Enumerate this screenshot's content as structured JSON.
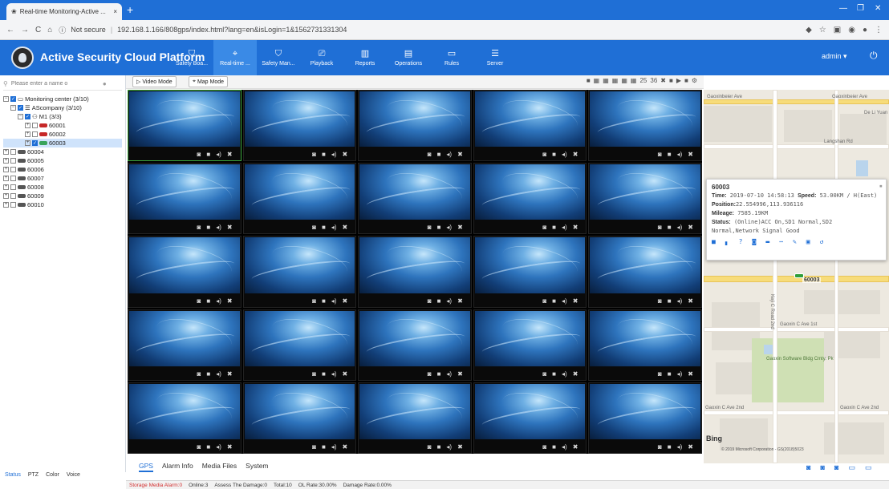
{
  "browser": {
    "tab_title": "Real-time Monitoring-Active ...",
    "not_secure": "Not secure",
    "url": "192.168.1.166/808gps/index.html?lang=en&isLogin=1&1562731331304"
  },
  "app": {
    "title": "Active Security Cloud Platform",
    "nav": [
      {
        "label": "Safety Boa..."
      },
      {
        "label": "Real-time ..."
      },
      {
        "label": "Safety Man..."
      },
      {
        "label": "Playback"
      },
      {
        "label": "Reports"
      },
      {
        "label": "Operations"
      },
      {
        "label": "Rules"
      },
      {
        "label": "Server"
      }
    ],
    "user": "admin ▾"
  },
  "sidebar": {
    "search_placeholder": "Please enter a name o",
    "tree": {
      "root": "Monitoring center (3/10)",
      "company": "AScompany (3/10)",
      "group": "M1 (3/3)",
      "vehicles": [
        "60001",
        "60002",
        "60003",
        "60004",
        "60005",
        "60006",
        "60007",
        "60008",
        "60009",
        "60010"
      ]
    },
    "bottom_tabs": [
      "Status",
      "PTZ",
      "Color",
      "Voice"
    ]
  },
  "toolbar": {
    "video_mode": "Video Mode",
    "map_mode": "Map Mode",
    "layout_25": "25",
    "layout_36": "36"
  },
  "bottom_tabs": [
    "GPS",
    "Alarm Info",
    "Media Files",
    "System"
  ],
  "map": {
    "labels": {
      "road_1": "Gaoxinbeier Ave",
      "road_2": "Gaoxinbeier Ave",
      "road_3": "Langshan Rd",
      "road_4": "Gaoxin C Ave 1st",
      "road_5": "Gaoxin C Ave 2nd",
      "road_6": "Gaoxin C Ave 2nd",
      "road_7": "Keji C Road 2nd",
      "park": "Gaoxin Software Bldg Cmty. Pk",
      "area": "De Li Yuan"
    },
    "popup": {
      "vehicle": "60003",
      "time_label": "Time:",
      "time": "2019-07-10 14:58:13",
      "speed_label": "Speed:",
      "speed": "53.00KM / H(East)",
      "position_label": "Position:",
      "position": "22.554996,113.936116",
      "mileage_label": "Mileage:",
      "mileage": "7585.19KM",
      "status_label": "Status:",
      "status": "(Online)ACC On,SD1 Normal,SD2 Normal,Network Signal Good"
    },
    "marker_label": "60003",
    "bing": "Bing",
    "copyright": "© 2019 Microsoft Corporation - GS(2018)5023"
  },
  "status_bar": {
    "storage_alarm": "Storage Media Alarm:0",
    "online": "Online:3",
    "assess": "Assess The Damage:0",
    "total": "Total:10",
    "ol_rate": "OL Rate:30.00%",
    "damage_rate": "Damage Rate:0.00%"
  },
  "colors": {
    "brand_blue": "#1f6fd6",
    "active_nav": "#3a8ae6",
    "alarm_red": "#d32f2f"
  }
}
